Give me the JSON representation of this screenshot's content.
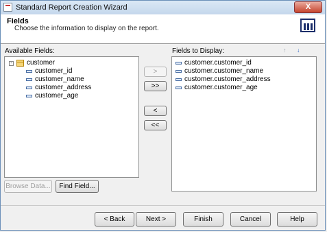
{
  "window": {
    "title": "Standard Report Creation Wizard",
    "close_label": "X"
  },
  "header": {
    "title": "Fields",
    "subtitle": "Choose the information to display on the report.",
    "icon": "report-columns-icon"
  },
  "available": {
    "label": "Available Fields:",
    "table_name": "customer",
    "fields": [
      "customer_id",
      "customer_name",
      "customer_address",
      "customer_age"
    ]
  },
  "display": {
    "label": "Fields to Display:",
    "fields": [
      "customer.customer_id",
      "customer.customer_name",
      "customer.customer_address",
      "customer.customer_age"
    ]
  },
  "move_buttons": {
    "add": ">",
    "add_all": ">>",
    "remove": "<",
    "remove_all": "<<"
  },
  "sort_icons": [
    "up-arrow-icon",
    "down-arrow-icon"
  ],
  "list_buttons": {
    "browse": "Browse Data...",
    "find": "Find Field..."
  },
  "footer": {
    "back": "< Back",
    "next": "Next >",
    "finish": "Finish",
    "cancel": "Cancel",
    "help": "Help"
  },
  "colors": {
    "accent": "#4a6fa5",
    "close_red": "#c6452f"
  }
}
